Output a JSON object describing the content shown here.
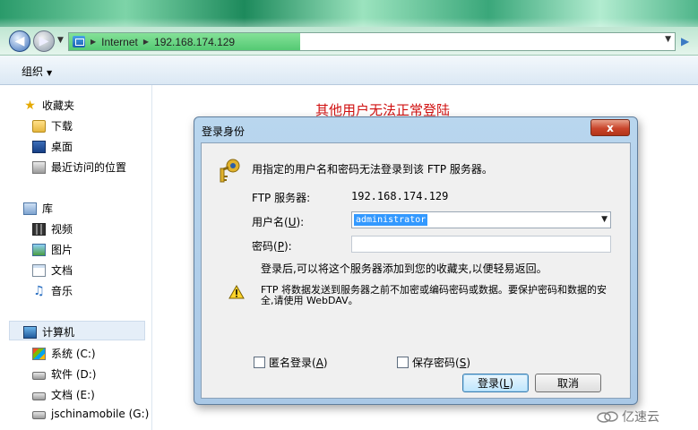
{
  "address_bar": {
    "segments": [
      "Internet",
      "192.168.174.129"
    ]
  },
  "toolbar": {
    "organize_label": "组织"
  },
  "sidebar": {
    "favorites": {
      "label": "收藏夹",
      "items": [
        "下载",
        "桌面",
        "最近访问的位置"
      ]
    },
    "libraries": {
      "label": "库",
      "items": [
        "视频",
        "图片",
        "文档",
        "音乐"
      ]
    },
    "computer": {
      "label": "计算机",
      "items": [
        "系统 (C:)",
        "软件 (D:)",
        "文档 (E:)",
        "jschinamobile (G:)"
      ]
    }
  },
  "annotation": {
    "text": "其他用户无法正常登陆"
  },
  "dialog": {
    "title": "登录身份",
    "close_label": "x",
    "message": "用指定的用户名和密码无法登录到该 FTP 服务器。",
    "server_label": "FTP 服务器:",
    "server_value": "192.168.174.129",
    "username_label": "用户名",
    "username_key": "U",
    "username_value": "administrator",
    "password_label": "密码",
    "password_key": "P",
    "password_value": "",
    "hint": "登录后,可以将这个服务器添加到您的收藏夹,以便轻易返回。",
    "warning": "FTP 将数据发送到服务器之前不加密或编码密码或数据。要保护密码和数据的安全,请使用 WebDAV。",
    "anonymous_label": "匿名登录",
    "anonymous_key": "A",
    "anonymous_checked": false,
    "save_password_label": "保存密码",
    "save_password_key": "S",
    "save_password_checked": false,
    "login_button": "登录",
    "login_key": "L",
    "cancel_button": "取消"
  },
  "watermark": {
    "text": "亿速云"
  },
  "colors": {
    "annotation": "#d01010",
    "selection": "#3399ff",
    "close_button": "#c9452b"
  }
}
